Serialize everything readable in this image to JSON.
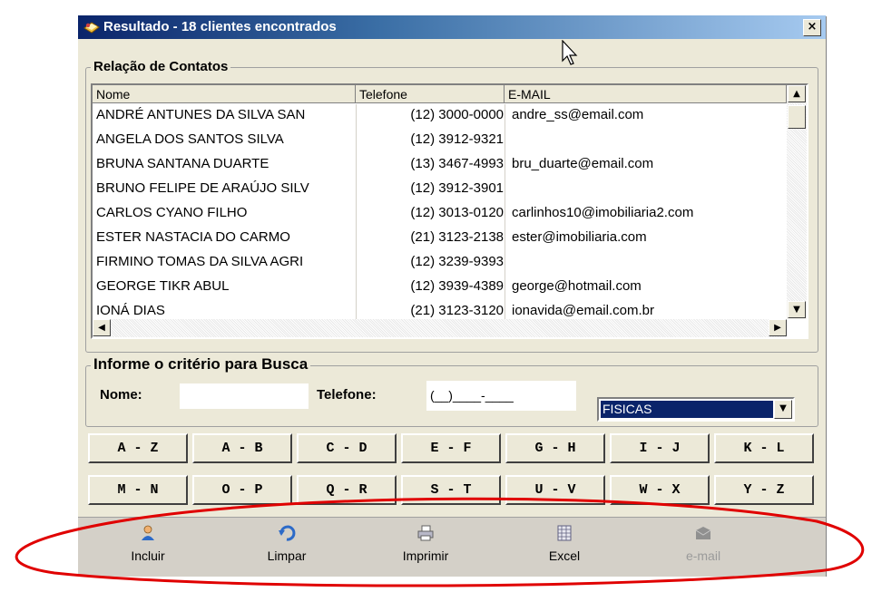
{
  "window": {
    "title": "Resultado - 18 clientes encontrados",
    "close_label": "×"
  },
  "contacts": {
    "group_label": "Relação de Contatos",
    "columns": [
      "Nome",
      "Telefone",
      "E-MAIL"
    ],
    "rows": [
      {
        "nome": "ANDRÉ ANTUNES DA SILVA SAN",
        "telefone": "(12) 3000-0000",
        "email": "andre_ss@email.com"
      },
      {
        "nome": "ANGELA DOS SANTOS SILVA",
        "telefone": "(12) 3912-9321",
        "email": ""
      },
      {
        "nome": "BRUNA SANTANA DUARTE",
        "telefone": "(13) 3467-4993",
        "email": "bru_duarte@email.com"
      },
      {
        "nome": "BRUNO FELIPE DE ARAÚJO SILV",
        "telefone": "(12) 3912-3901",
        "email": ""
      },
      {
        "nome": "CARLOS CYANO FILHO",
        "telefone": "(12) 3013-0120",
        "email": "carlinhos10@imobiliaria2.com"
      },
      {
        "nome": "ESTER NASTACIA DO CARMO",
        "telefone": "(21) 3123-2138",
        "email": "ester@imobiliaria.com"
      },
      {
        "nome": "FIRMINO TOMAS DA SILVA AGRI",
        "telefone": "(12) 3239-9393",
        "email": ""
      },
      {
        "nome": "GEORGE TIKR ABUL",
        "telefone": "(12) 3939-4389",
        "email": "george@hotmail.com"
      },
      {
        "nome": "IONÁ DIAS",
        "telefone": "(21) 3123-3120",
        "email": "ionavida@email.com.br"
      }
    ]
  },
  "search": {
    "group_label": "Informe o critério para Busca",
    "nome_label": "Nome:",
    "nome_value": "",
    "telefone_label": "Telefone:",
    "telefone_mask": "(__)____-____",
    "tipo_selected": "FISICAS"
  },
  "alphabet": [
    "A - Z",
    "A - B",
    "C - D",
    "E - F",
    "G - H",
    "I - J",
    "K - L",
    "M - N",
    "O - P",
    "Q - R",
    "S - T",
    "U - V",
    "W - X",
    "Y - Z"
  ],
  "toolbar": [
    {
      "label": "Incluir",
      "icon": "user-add-icon",
      "enabled": true
    },
    {
      "label": "Limpar",
      "icon": "undo-icon",
      "enabled": true
    },
    {
      "label": "Imprimir",
      "icon": "printer-icon",
      "enabled": true
    },
    {
      "label": "Excel",
      "icon": "spreadsheet-icon",
      "enabled": true
    },
    {
      "label": "e-mail",
      "icon": "email-icon",
      "enabled": false
    }
  ],
  "colors": {
    "title_bar": "#0a246a",
    "window_bg": "#ece9d8",
    "selection": "#0a246a",
    "annotation": "#e00000"
  }
}
